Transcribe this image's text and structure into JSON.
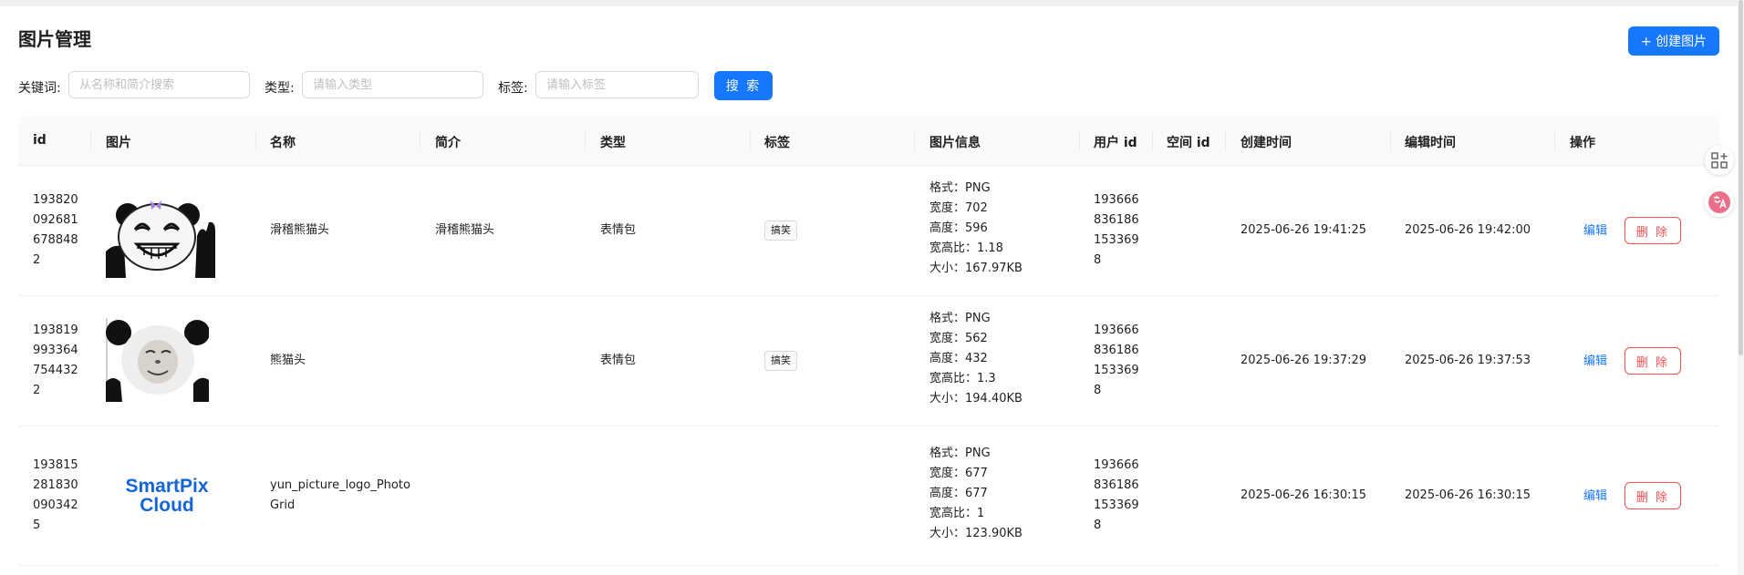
{
  "page": {
    "title": "图片管理",
    "create_button": "+ 创建图片"
  },
  "filters": {
    "keyword_label": "关键词:",
    "keyword_placeholder": "从名称和简介搜索",
    "category_label": "类型:",
    "category_placeholder": "请输入类型",
    "tags_label": "标签:",
    "tags_placeholder": "请输入标签",
    "search_button": "搜 索"
  },
  "table": {
    "columns": [
      "id",
      "图片",
      "名称",
      "简介",
      "类型",
      "标签",
      "图片信息",
      "用户 id",
      "空间 id",
      "创建时间",
      "编辑时间",
      "操作"
    ],
    "edit_label": "编辑",
    "delete_label": "删 除",
    "rows": [
      {
        "id_lines": [
          "193820",
          "092681",
          "678848",
          "2"
        ],
        "image": "panda-grin-meme",
        "name": "滑稽熊猫头",
        "intro": "滑稽熊猫头",
        "category": "表情包",
        "tag": "搞笑",
        "info": [
          "格式：PNG",
          "宽度：702",
          "高度：596",
          "宽高比：1.18",
          "大小：167.97KB"
        ],
        "user_id_lines": [
          "193666",
          "836186",
          "153369",
          "8"
        ],
        "space_id": "",
        "created": "2025-06-26 19:41:25",
        "edited": "2025-06-26 19:42:00"
      },
      {
        "id_lines": [
          "193819",
          "993364",
          "754432",
          "2"
        ],
        "image": "panda-head-meme",
        "name": "熊猫头",
        "intro": "",
        "category": "表情包",
        "tag": "搞笑",
        "info": [
          "格式：PNG",
          "宽度：562",
          "高度：432",
          "宽高比：1.3",
          "大小：194.40KB"
        ],
        "user_id_lines": [
          "193666",
          "836186",
          "153369",
          "8"
        ],
        "space_id": "",
        "created": "2025-06-26 19:37:29",
        "edited": "2025-06-26 19:37:53"
      },
      {
        "id_lines": [
          "193815",
          "281830",
          "090342",
          "5"
        ],
        "image": "smartpix-logo",
        "image_logo_text": [
          "SmartPix",
          "Cloud"
        ],
        "name_lines": [
          "yun_picture_logo_Photo",
          "Grid"
        ],
        "intro": "",
        "category": "",
        "tag": "",
        "info": [
          "格式：PNG",
          "宽度：677",
          "高度：677",
          "宽高比：1",
          "大小：123.90KB"
        ],
        "user_id_lines": [
          "193666",
          "836186",
          "153369",
          "8"
        ],
        "space_id": "",
        "created": "2025-06-26 16:30:15",
        "edited": "2025-06-26 16:30:15"
      }
    ]
  },
  "side_tools": [
    "qr-grid-icon",
    "translate-icon"
  ],
  "colors": {
    "primary": "#1677ff",
    "danger": "#ff4d4f",
    "header_bg": "#fafafa"
  }
}
